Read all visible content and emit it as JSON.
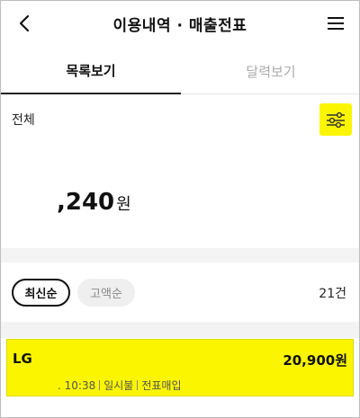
{
  "header": {
    "title": "이용내역 · 매출전표",
    "back_icon": "chevron-left-icon",
    "menu_icon": "hamburger-icon"
  },
  "tabs": [
    {
      "label": "목록보기",
      "active": true
    },
    {
      "label": "달력보기",
      "active": false
    }
  ],
  "filter": {
    "label": "전체",
    "icon": "sliders-icon",
    "accent": "#fbf600"
  },
  "summary": {
    "amount": ",240",
    "unit": "원"
  },
  "sort": {
    "options": [
      {
        "label": "최신순",
        "selected": true
      },
      {
        "label": "고액순",
        "selected": false
      }
    ],
    "count": "21건"
  },
  "transactions": [
    {
      "merchant": "LG",
      "amount": "20,900원",
      "time": ". 10:38",
      "payment": "일시불",
      "status": "전표매입"
    }
  ]
}
